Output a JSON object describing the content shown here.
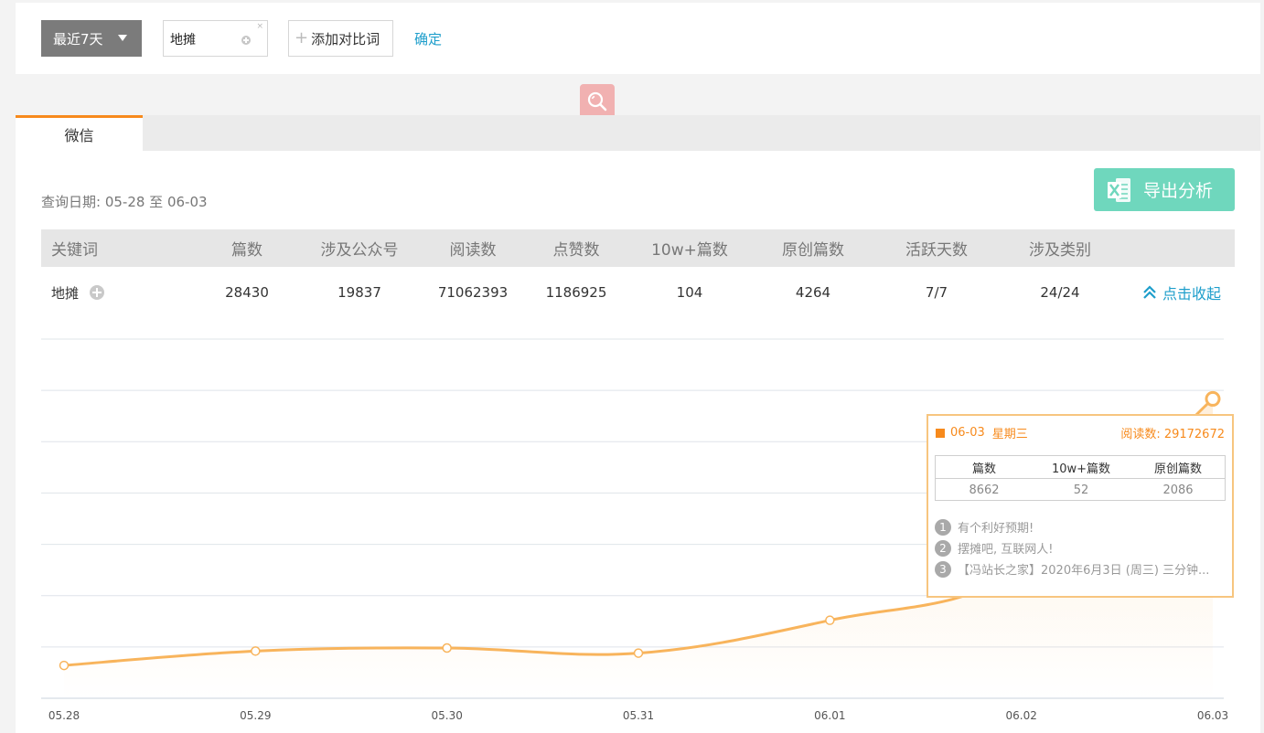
{
  "filter": {
    "range_label": "最近7天",
    "keyword_value": "地摊",
    "remove_mark": "×",
    "add_compare_label": "添加对比词",
    "confirm_label": "确定"
  },
  "tabs": [
    {
      "label": "微信",
      "active": true
    }
  ],
  "query": {
    "label": "查询日期: 05-28 至 06-03"
  },
  "export": {
    "label": "导出分析",
    "icon": "excel-icon"
  },
  "stats": {
    "headers": [
      "关键词",
      "篇数",
      "涉及公众号",
      "阅读数",
      "点赞数",
      "10w+篇数",
      "原创篇数",
      "活跃天数",
      "涉及类别"
    ],
    "row": {
      "keyword": "地摊",
      "values": [
        "28430",
        "19837",
        "71062393",
        "1186925",
        "104",
        "4264",
        "7/7",
        "24/24"
      ],
      "collapse_label": "点击收起"
    }
  },
  "chart_data": {
    "type": "area",
    "x": [
      "05.28",
      "05.29",
      "05.30",
      "05.31",
      "06.01",
      "06.02",
      "06.03"
    ],
    "series": [
      {
        "name": "阅读数",
        "values": [
          3200000,
          4600000,
          4900000,
          4400000,
          7600000,
          12400000,
          29172672
        ]
      }
    ],
    "ylim": [
      0,
      35000000
    ],
    "y_gridlines": 7,
    "y_tick_labels_visible": false,
    "color": "#f8b45c"
  },
  "tooltip": {
    "date": "06-03",
    "weekday": "星期三",
    "read_label": "阅读数: 29172672",
    "table": {
      "headers": [
        "篇数",
        "10w+篇数",
        "原创篇数"
      ],
      "values": [
        "8662",
        "52",
        "2086"
      ]
    },
    "articles": [
      {
        "rank": "1",
        "title": "有个利好预期!"
      },
      {
        "rank": "2",
        "title": "摆摊吧, 互联网人!"
      },
      {
        "rank": "3",
        "title": "【冯站长之家】2020年6月3日 (周三) 三分钟..."
      }
    ]
  },
  "colors": {
    "accent_orange": "#f78a1c",
    "line_orange": "#f8b45c",
    "link_blue": "#1e9ecb",
    "export_green": "#6fd7bd"
  }
}
